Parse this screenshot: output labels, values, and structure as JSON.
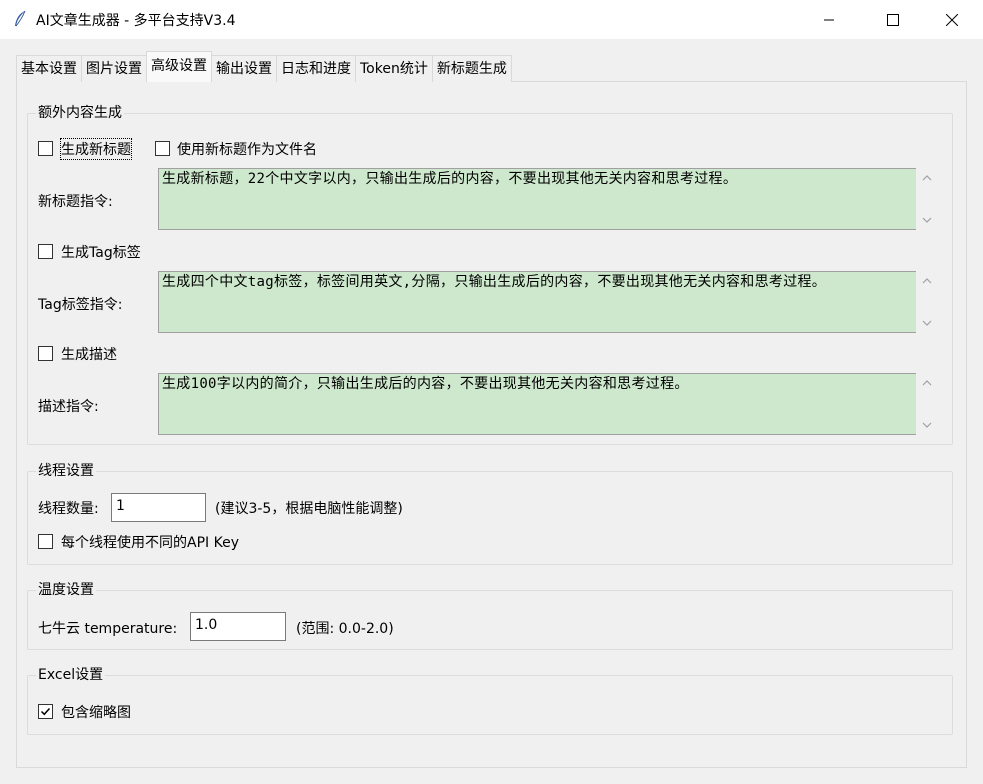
{
  "window": {
    "title": "AI文章生成器 - 多平台支持V3.4",
    "app_icon": "feather-icon",
    "controls": [
      "minimize-icon",
      "maximize-icon",
      "close-icon"
    ]
  },
  "tabs": [
    {
      "label": "基本设置",
      "active": false
    },
    {
      "label": "图片设置",
      "active": false
    },
    {
      "label": "高级设置",
      "active": true
    },
    {
      "label": "输出设置",
      "active": false
    },
    {
      "label": "日志和进度",
      "active": false
    },
    {
      "label": "Token统计",
      "active": false
    },
    {
      "label": "新标题生成",
      "active": false
    }
  ],
  "extra_content": {
    "title": "额外内容生成",
    "gen_new_title": {
      "label": "生成新标题",
      "checked": false
    },
    "use_title_as_filename": {
      "label": "使用新标题作为文件名",
      "checked": false
    },
    "title_prompt_label": "新标题指令:",
    "title_prompt_value": "生成新标题，22个中文字以内，只输出生成后的内容，不要出现其他无关内容和思考过程。",
    "gen_tags": {
      "label": "生成Tag标签",
      "checked": false
    },
    "tag_prompt_label": "Tag标签指令:",
    "tag_prompt_value": "生成四个中文tag标签，标签间用英文,分隔，只输出生成后的内容，不要出现其他无关内容和思考过程。",
    "gen_desc": {
      "label": "生成描述",
      "checked": false
    },
    "desc_prompt_label": "描述指令:",
    "desc_prompt_value": "生成100字以内的简介，只输出生成后的内容，不要出现其他无关内容和思考过程。"
  },
  "thread_settings": {
    "title": "线程设置",
    "count_label": "线程数量:",
    "count_value": "1",
    "hint": "(建议3-5，根据电脑性能调整)",
    "per_thread_key": {
      "label": "每个线程使用不同的API Key",
      "checked": false
    }
  },
  "temperature_settings": {
    "title": "温度设置",
    "label": "七牛云 temperature:",
    "value": "1.0",
    "hint": "(范围: 0.0-2.0)"
  },
  "excel_settings": {
    "title": "Excel设置",
    "include_thumbnail": {
      "label": "包含缩略图",
      "checked": true
    }
  },
  "colors": {
    "textarea_bg": "#cde8cc",
    "window_bg": "#f0f0f0"
  }
}
